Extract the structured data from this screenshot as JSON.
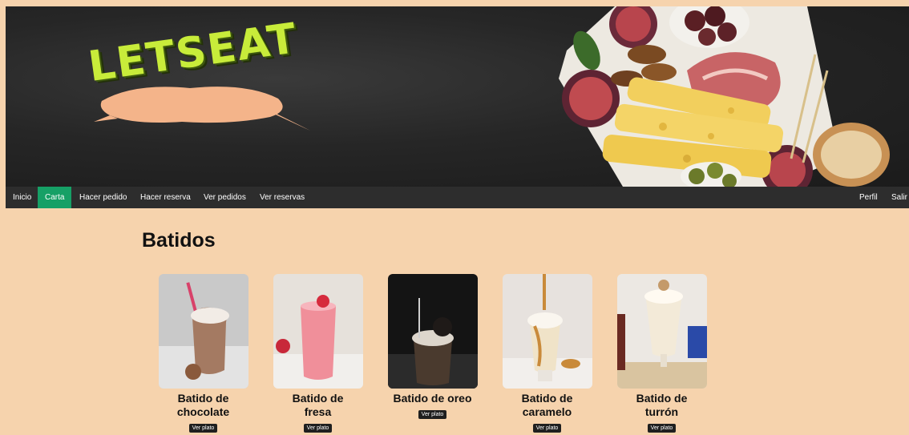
{
  "brand": {
    "logo_text": "LETSEAT"
  },
  "nav": {
    "items": [
      {
        "label": "Inicio",
        "active": false
      },
      {
        "label": "Carta",
        "active": true
      },
      {
        "label": "Hacer pedido",
        "active": false
      },
      {
        "label": "Hacer reserva",
        "active": false
      },
      {
        "label": "Ver pedidos",
        "active": false
      },
      {
        "label": "Ver reservas",
        "active": false
      }
    ],
    "right_items": [
      {
        "label": "Perfil"
      },
      {
        "label": "Salir"
      }
    ]
  },
  "section": {
    "title": "Batidos"
  },
  "products": [
    {
      "name": "Batido de chocolate",
      "button": "Ver plato"
    },
    {
      "name": "Batido de fresa",
      "button": "Ver plato"
    },
    {
      "name": "Batido de oreo",
      "button": "Ver plato"
    },
    {
      "name": "Batido de caramelo",
      "button": "Ver plato"
    },
    {
      "name": "Batido de turrón",
      "button": "Ver plato"
    }
  ],
  "colors": {
    "nav_bg": "#2d2d2d",
    "nav_active": "#16a066",
    "page_bg": "#f6d3ad"
  }
}
